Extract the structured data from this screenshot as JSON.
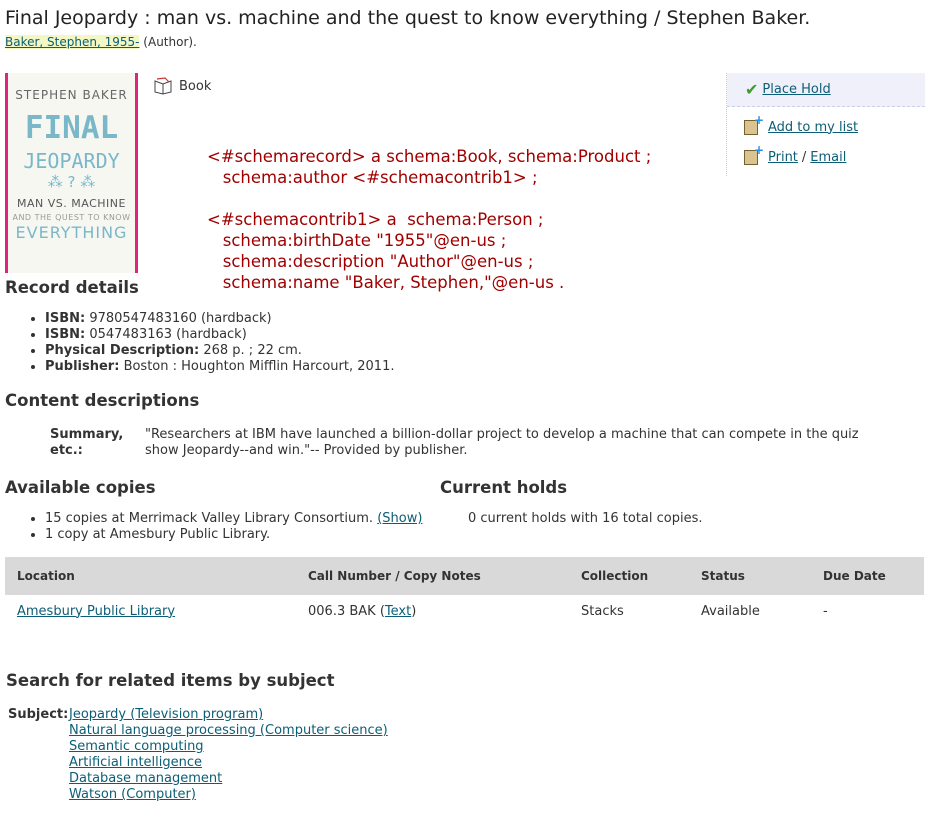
{
  "title": "Final Jeopardy : man vs. machine and the quest to know everything / Stephen Baker.",
  "author": {
    "name": "Baker, Stephen, 1955-",
    "role": "(Author)."
  },
  "cover": {
    "author": "STEPHEN BAKER",
    "line1": "FINAL",
    "line2": "JEOPARDY",
    "line3": "MAN VS. MACHINE",
    "line4": "AND THE QUEST TO KNOW",
    "line5": "EVERYTHING"
  },
  "format": {
    "label": "Book",
    "icon": "open-book-icon"
  },
  "schema_lines": [
    "<#schemarecord> a schema:Book, schema:Product ;",
    "   schema:author <#schemacontrib1> ;",
    "",
    "<#schemacontrib1> a  schema:Person ;",
    "   schema:birthDate \"1955\"@en-us ;",
    "   schema:description \"Author\"@en-us ;",
    "   schema:name \"Baker, Stephen,\"@en-us ."
  ],
  "actions": {
    "place_hold": "Place Hold",
    "add_to_list": "Add to my list",
    "print": "Print",
    "separator": "/",
    "email": "Email"
  },
  "record_details": {
    "heading": "Record details",
    "items": [
      {
        "label": "ISBN:",
        "value": "9780547483160 (hardback)"
      },
      {
        "label": "ISBN:",
        "value": "0547483163 (hardback)"
      },
      {
        "label": "Physical Description:",
        "value": "268 p. ; 22 cm."
      },
      {
        "label": "Publisher:",
        "value": "Boston : Houghton Mifflin Harcourt, 2011."
      }
    ]
  },
  "content_descriptions": {
    "heading": "Content descriptions",
    "label": "Summary, etc.:",
    "text": "\"Researchers at IBM have launched a billion-dollar project to develop a machine that can compete in the quiz show Jeopardy--and win.\"-- Provided by publisher."
  },
  "available_copies": {
    "heading": "Available copies",
    "line1": "15 copies at Merrimack Valley Library Consortium.",
    "show_link": "(Show)",
    "line2": "1 copy at Amesbury Public Library."
  },
  "current_holds": {
    "heading": "Current holds",
    "text": "0 current holds with 16 total copies."
  },
  "copies_table": {
    "headers": [
      "Location",
      "Call Number / Copy Notes",
      "Collection",
      "Status",
      "Due Date"
    ],
    "row": {
      "location": "Amesbury Public Library",
      "call_number": "006.3 BAK",
      "text_link": "Text",
      "collection": "Stacks",
      "status": "Available",
      "due_date": "-"
    }
  },
  "subjects": {
    "heading": "Search for related items by subject",
    "label": "Subject:",
    "items": [
      "Jeopardy (Television program)",
      "Natural language processing (Computer science)",
      "Semantic computing",
      "Artificial intelligence",
      "Database management",
      "Watson (Computer)"
    ]
  }
}
